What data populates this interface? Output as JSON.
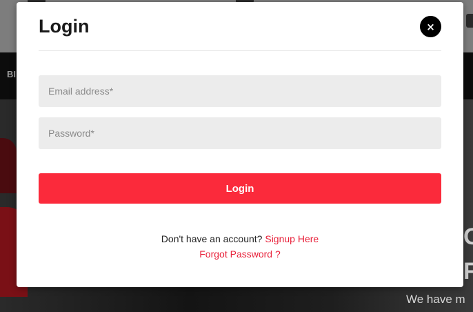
{
  "background": {
    "nav_text": "BI",
    "hero_letters": "O\nF",
    "tagline": "We have m"
  },
  "modal": {
    "title": "Login",
    "close_label": "×",
    "email": {
      "placeholder": "Email address*",
      "value": ""
    },
    "password": {
      "placeholder": "Password*",
      "value": ""
    },
    "login_label": "Login",
    "signup_prompt": "Don't have an account?",
    "signup_link": "Signup Here",
    "forgot_link": "Forgot Password ?"
  },
  "colors": {
    "accent": "#fb2a3b",
    "link": "#e8213a",
    "field_bg": "#ececec"
  },
  "icons": {
    "close": "close-icon"
  }
}
